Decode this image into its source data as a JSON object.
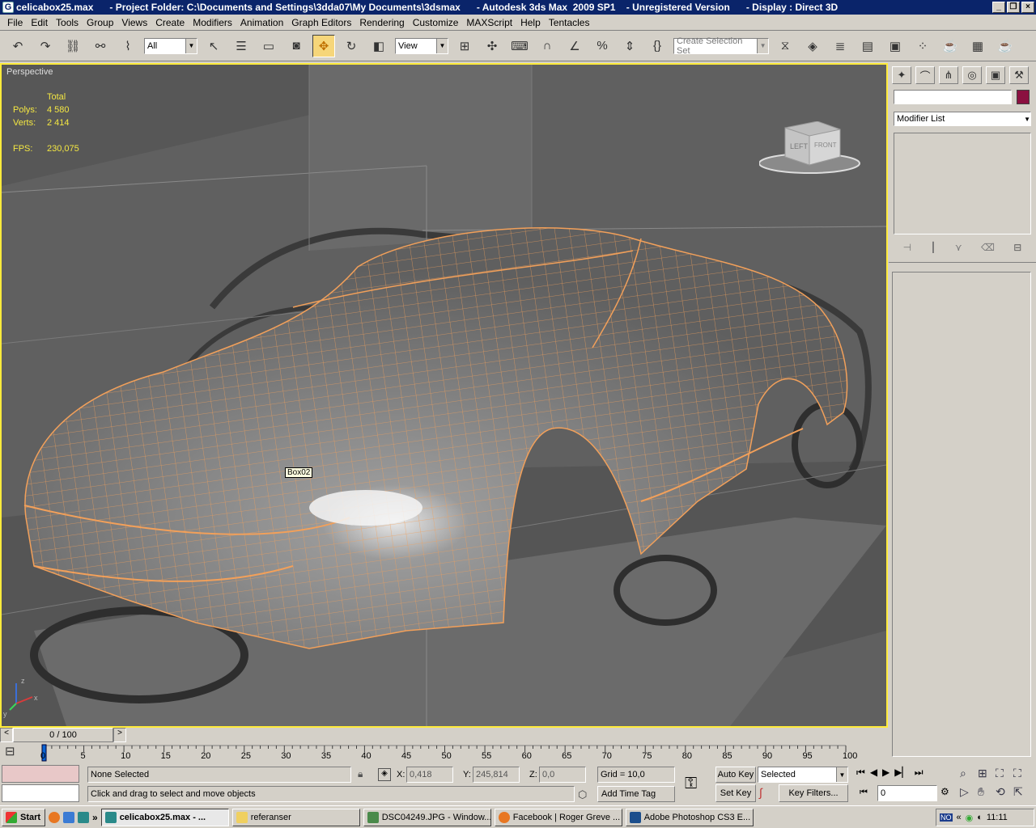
{
  "window": {
    "title": "celicabox25.max      - Project Folder: C:\\Documents and Settings\\3dda07\\My Documents\\3dsmax      - Autodesk 3ds Max  2009 SP1    - Unregistered Version      - Display : Direct 3D",
    "minimize": "_",
    "restore": "❐",
    "close": "×"
  },
  "menu": [
    "File",
    "Edit",
    "Tools",
    "Group",
    "Views",
    "Create",
    "Modifiers",
    "Animation",
    "Graph Editors",
    "Rendering",
    "Customize",
    "MAXScript",
    "Help",
    "Tentacles"
  ],
  "toolbar": {
    "filter_select": "All",
    "ref_coord": "View",
    "selection_set_placeholder": "Create Selection Set",
    "icons": [
      "undo-icon",
      "redo-icon",
      "select-link-icon",
      "unlink-icon",
      "bind-space-warp-icon",
      "select-object-icon",
      "select-by-name-icon",
      "rect-region-icon",
      "window-crossing-icon",
      "select-move-icon",
      "select-rotate-icon",
      "select-scale-icon",
      "pivot-center-icon",
      "manipulate-icon",
      "keyboard-shortcut-icon",
      "snap-3-icon",
      "angle-snap-icon",
      "percent-snap-icon",
      "spinner-snap-icon",
      "edit-named-sel-icon",
      "mirror-icon",
      "align-icon",
      "layer-manager-icon",
      "curve-editor-icon",
      "schematic-view-icon",
      "material-editor-icon",
      "render-setup-icon",
      "rendered-frame-icon",
      "render-icon"
    ]
  },
  "viewport": {
    "label": "Perspective",
    "stats_header": "Total",
    "stats": [
      {
        "key": "Polys:",
        "value": "4 580"
      },
      {
        "key": "Verts:",
        "value": "2 414"
      }
    ],
    "fps_key": "FPS:",
    "fps_value": "230,075",
    "tooltip": "Box02",
    "viewcube_left": "LEFT",
    "viewcube_front": "FRONT",
    "axis_x": "x",
    "axis_y": "y",
    "axis_z": "z",
    "colors": {
      "border": "#ffeb3b",
      "wire": "#f2a05a",
      "stats": "#f4e742"
    }
  },
  "command_panel": {
    "tabs": [
      "create-icon",
      "modify-icon",
      "hierarchy-icon",
      "motion-icon",
      "display-icon",
      "utilities-icon"
    ],
    "name_field": "",
    "color_swatch": "#8b1040",
    "modifier_list": "Modifier List",
    "stack_buttons": [
      "pin-stack-icon",
      "show-end-result-icon",
      "make-unique-icon",
      "remove-modifier-icon",
      "configure-sets-icon"
    ]
  },
  "time_slider": {
    "value": "0 / 100",
    "prev": "<",
    "next": ">"
  },
  "track": {
    "ticks": [
      "0",
      "5",
      "10",
      "15",
      "20",
      "25",
      "30",
      "35",
      "40",
      "45",
      "50",
      "55",
      "60",
      "65",
      "70",
      "75",
      "80",
      "85",
      "90",
      "95",
      "100"
    ]
  },
  "status": {
    "selection": "None Selected",
    "prompt": "Click and drag to select and move objects",
    "x_label": "X:",
    "x_value": "0,418",
    "y_label": "Y:",
    "y_value": "245,814",
    "z_label": "Z:",
    "z_value": "0,0",
    "grid": "Grid = 10,0",
    "add_time_tag": "Add Time Tag",
    "auto_key": "Auto Key",
    "set_key": "Set Key",
    "key_mode": "Selected",
    "key_filters": "Key Filters...",
    "frame": "0"
  },
  "taskbar": {
    "start": "Start",
    "quicklaunch_more": "»",
    "tasks": [
      {
        "label": "celicabox25.max  - ...",
        "active": true
      },
      {
        "label": "referanser",
        "active": false
      },
      {
        "label": "DSC04249.JPG - Window...",
        "active": false
      },
      {
        "label": "Facebook | Roger Greve ...",
        "active": false
      },
      {
        "label": "Adobe Photoshop CS3 E...",
        "active": false
      }
    ],
    "tray_lang": "NO",
    "clock": "11:11"
  }
}
